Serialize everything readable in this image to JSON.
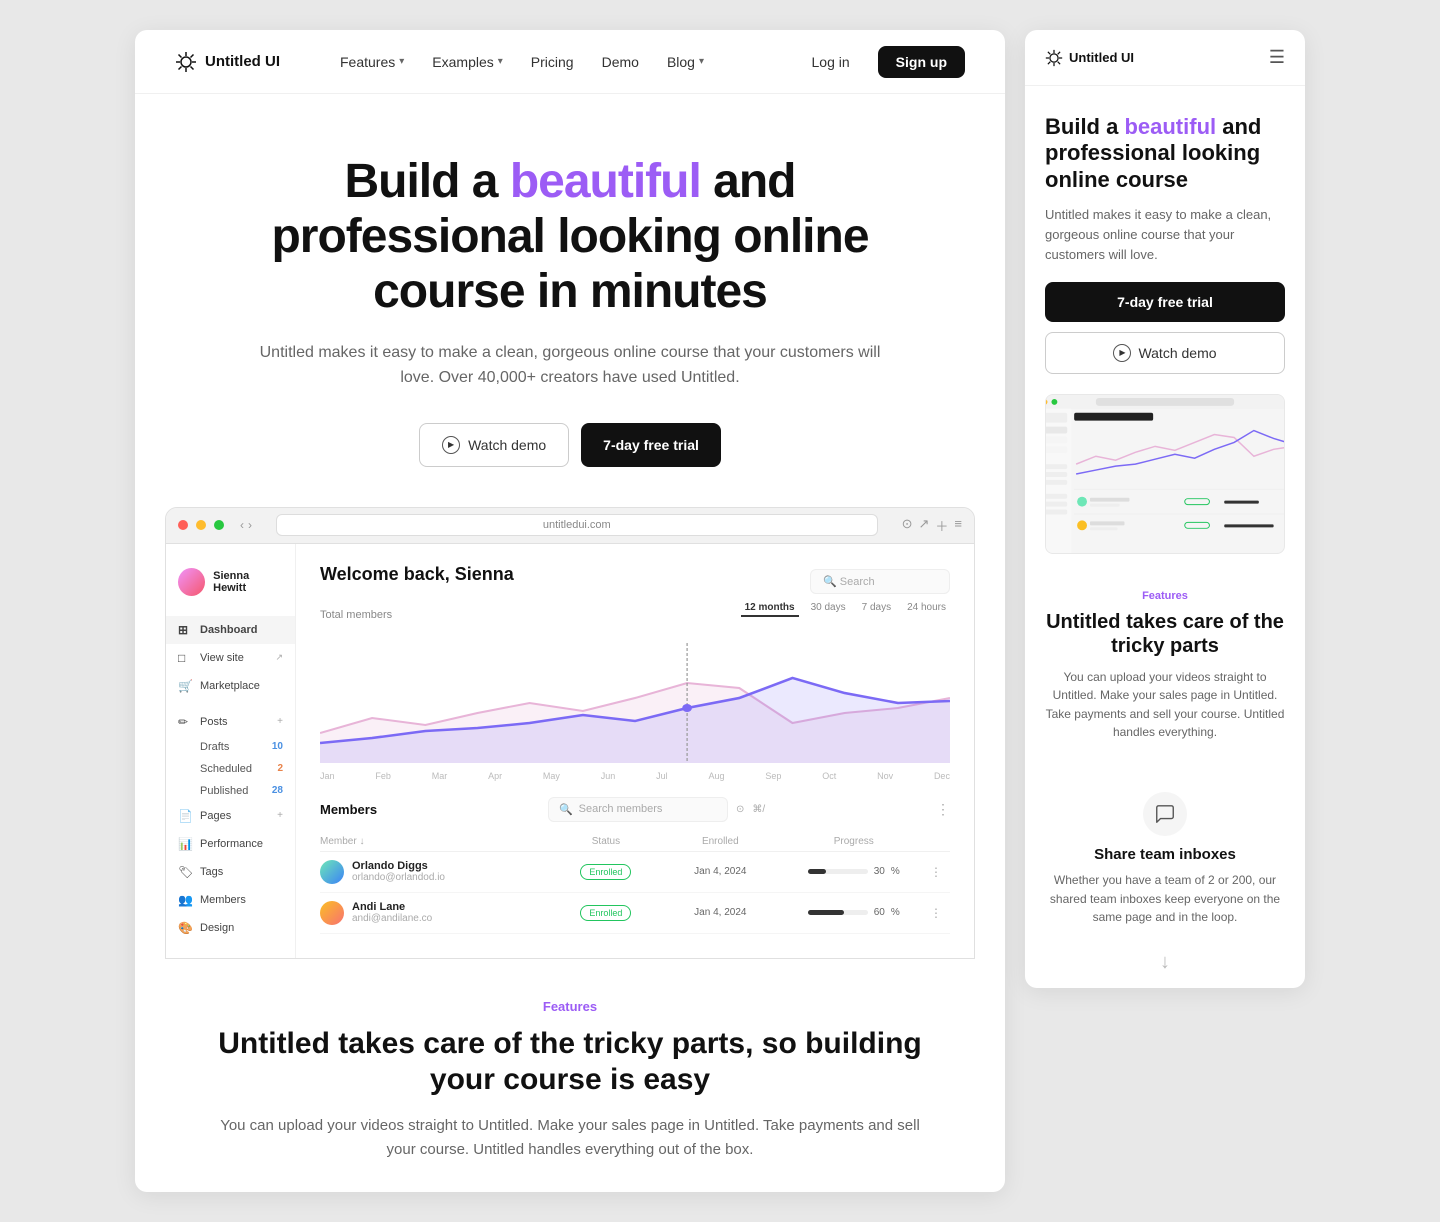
{
  "brand": {
    "name": "Untitled UI",
    "logo_symbol": "✳"
  },
  "nav": {
    "links": [
      {
        "label": "Features",
        "has_dropdown": true
      },
      {
        "label": "Examples",
        "has_dropdown": true
      },
      {
        "label": "Pricing",
        "has_dropdown": false
      },
      {
        "label": "Demo",
        "has_dropdown": false
      },
      {
        "label": "Blog",
        "has_dropdown": true
      }
    ],
    "login_label": "Log in",
    "signup_label": "Sign up"
  },
  "hero": {
    "title_part1": "Build a ",
    "title_highlight": "beautiful",
    "title_part2": " and professional looking online course in minutes",
    "subtitle": "Untitled makes it easy to make a clean, gorgeous online course that your customers will love. Over 40,000+ creators have used Untitled.",
    "watch_demo_label": "Watch demo",
    "trial_label": "7-day free trial"
  },
  "dashboard_mockup": {
    "url": "untitledui.com",
    "username": "Sienna Hewitt",
    "welcome": "Welcome back, Sienna",
    "sidebar_items": [
      {
        "label": "Dashboard",
        "icon": "⊞",
        "active": true
      },
      {
        "label": "View site",
        "icon": "□"
      },
      {
        "label": "Marketplace",
        "icon": "🛒"
      }
    ],
    "sidebar_posts": {
      "label": "Posts",
      "children": [
        {
          "label": "Drafts",
          "count": "10",
          "badge_color": "blue"
        },
        {
          "label": "Scheduled",
          "count": "2",
          "badge_color": "orange"
        },
        {
          "label": "Published",
          "count": "28",
          "badge_color": "blue"
        }
      ]
    },
    "sidebar_other": [
      {
        "label": "Pages",
        "icon": "📄"
      },
      {
        "label": "Performance",
        "icon": "📊"
      },
      {
        "label": "Tags",
        "icon": "🏷"
      },
      {
        "label": "Members",
        "icon": "👥"
      },
      {
        "label": "Design",
        "icon": "🎨"
      }
    ],
    "total_members_label": "Total members",
    "time_filters": [
      "12 months",
      "30 days",
      "7 days",
      "24 hours"
    ],
    "active_filter": "12 months",
    "chart_months": [
      "Jan",
      "Feb",
      "Mar",
      "Apr",
      "May",
      "Jun",
      "Jul",
      "Aug",
      "Sep",
      "Oct",
      "Nov",
      "Dec"
    ],
    "members_section": {
      "title": "Members",
      "search_placeholder": "Search members",
      "columns": [
        "Member",
        "Status",
        "Enrolled",
        "Progress"
      ],
      "rows": [
        {
          "name": "Orlando Diggs",
          "email": "orlando@orlandod.io",
          "status": "Enrolled",
          "enrolled_date": "Jan 4, 2024",
          "progress": 30
        },
        {
          "name": "Andi Lane",
          "email": "andi@andilane.co",
          "status": "Enrolled",
          "enrolled_date": "Jan 4, 2024",
          "progress": 60
        }
      ]
    }
  },
  "features": {
    "label": "Features",
    "title": "Untitled takes care of the tricky parts, so building your course is easy",
    "description": "You can upload your videos straight to Untitled. Make your sales page in Untitled. Take payments and sell your course. Untitled handles everything out of the box."
  },
  "right_panel": {
    "hero": {
      "title_part1": "Build a ",
      "title_highlight": "beautiful",
      "title_part2": " and professional looking online course",
      "subtitle": "Untitled makes it easy to make a clean, gorgeous online course that your customers will love.",
      "trial_label": "7-day free trial",
      "watch_demo_label": "Watch demo"
    },
    "features": {
      "label": "Features",
      "title": "Untitled takes care of the tricky parts",
      "description": "You can upload your videos straight to Untitled. Make your sales page in Untitled. Take payments and sell your course. Untitled handles everything."
    },
    "share_inbox": {
      "icon": "💬",
      "title": "Share team inboxes",
      "description": "Whether you have a team of 2 or 200, our shared team inboxes keep everyone on the same page and in the loop."
    }
  }
}
